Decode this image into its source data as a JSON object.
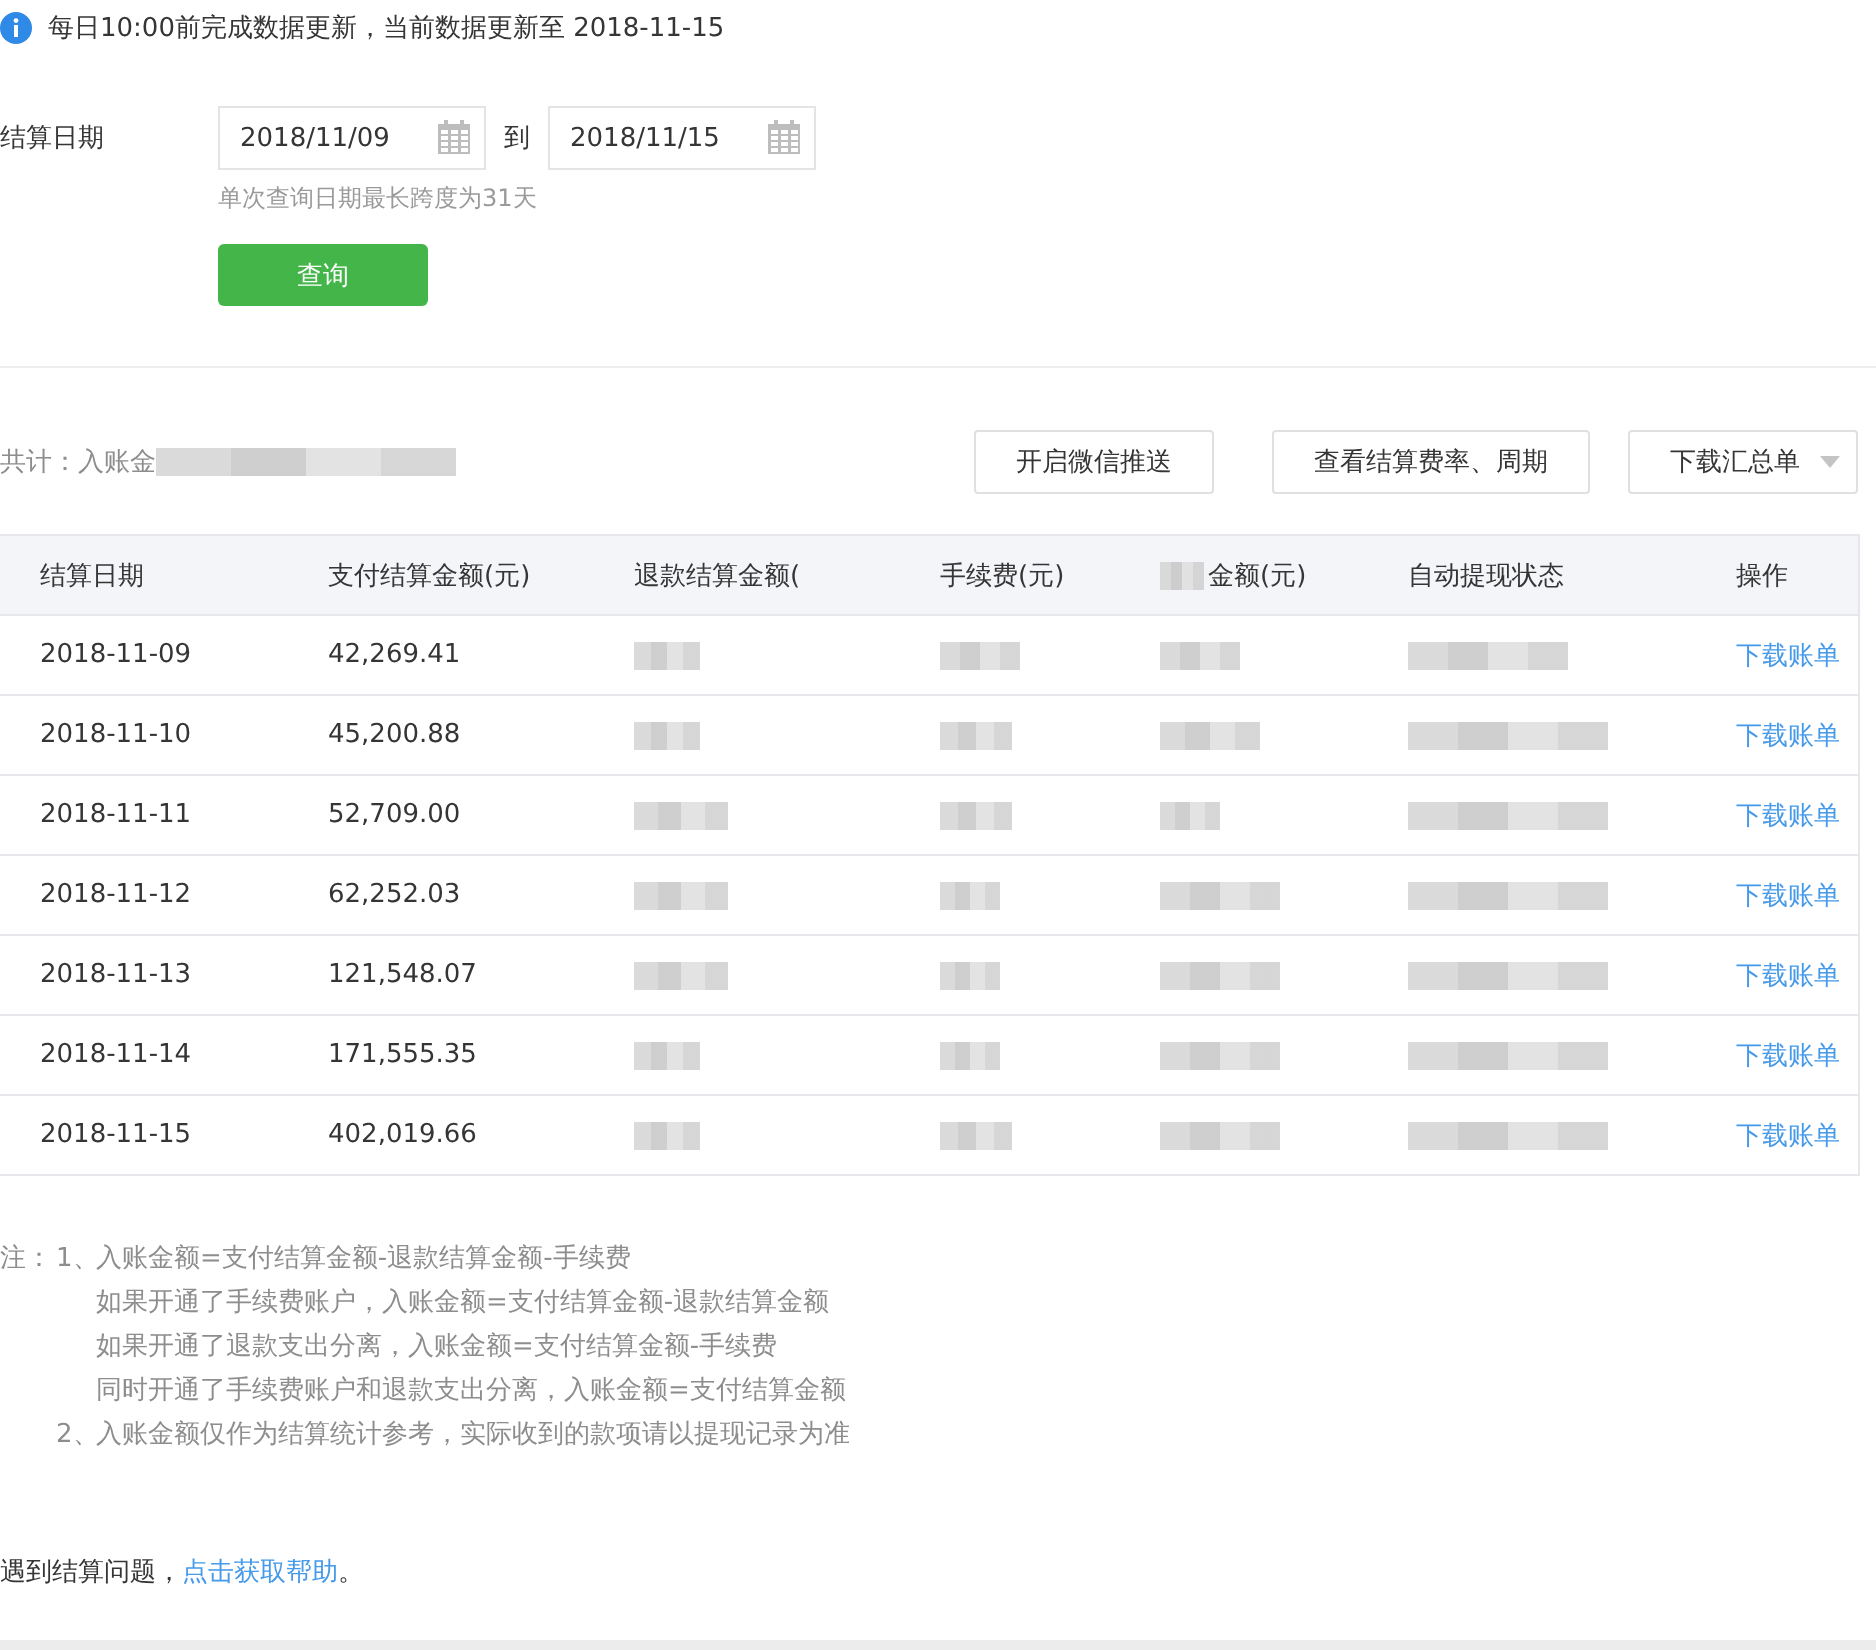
{
  "notice": "每日10:00前完成数据更新，当前数据更新至 2018-11-15",
  "form": {
    "label": "结算日期",
    "start": "2018/11/09",
    "separator": "到",
    "end": "2018/11/15",
    "hint": "单次查询日期最长跨度为31天",
    "submit": "查询"
  },
  "summary": {
    "label": "共计：入账金"
  },
  "actions": [
    {
      "label": "开启微信推送",
      "kind": "button"
    },
    {
      "label": "查看结算费率、周期",
      "kind": "button"
    },
    {
      "label": "下载汇总单",
      "kind": "dropdown"
    }
  ],
  "table": {
    "columns": [
      "结算日期",
      "支付结算金额(元)",
      "退款结算金额(",
      "手续费(元)",
      "金额(元)",
      "自动提现状态",
      "操作"
    ],
    "rows": [
      {
        "date": "2018-11-09",
        "amount": "42,269.41",
        "action": "下载账单"
      },
      {
        "date": "2018-11-10",
        "amount": "45,200.88",
        "action": "下载账单"
      },
      {
        "date": "2018-11-11",
        "amount": "52,709.00",
        "action": "下载账单"
      },
      {
        "date": "2018-11-12",
        "amount": "62,252.03",
        "action": "下载账单"
      },
      {
        "date": "2018-11-13",
        "amount": "121,548.07",
        "action": "下载账单"
      },
      {
        "date": "2018-11-14",
        "amount": "171,555.35",
        "action": "下载账单"
      },
      {
        "date": "2018-11-15",
        "amount": "402,019.66",
        "action": "下载账单"
      }
    ]
  },
  "notes": {
    "prefix": "注：",
    "items": [
      {
        "number": "1、",
        "lines": [
          "入账金额=支付结算金额-退款结算金额-手续费",
          "如果开通了手续费账户，入账金额=支付结算金额-退款结算金额",
          "如果开通了退款支出分离，入账金额=支付结算金额-手续费",
          "同时开通了手续费账户和退款支出分离，入账金额=支付结算金额"
        ]
      },
      {
        "number": "2、",
        "lines": [
          "入账金额仅作为结算统计参考，实际收到的款项请以提现记录为准"
        ]
      }
    ]
  },
  "help": {
    "text": "遇到结算问题，",
    "link": "点击获取帮助",
    "end": "。"
  }
}
